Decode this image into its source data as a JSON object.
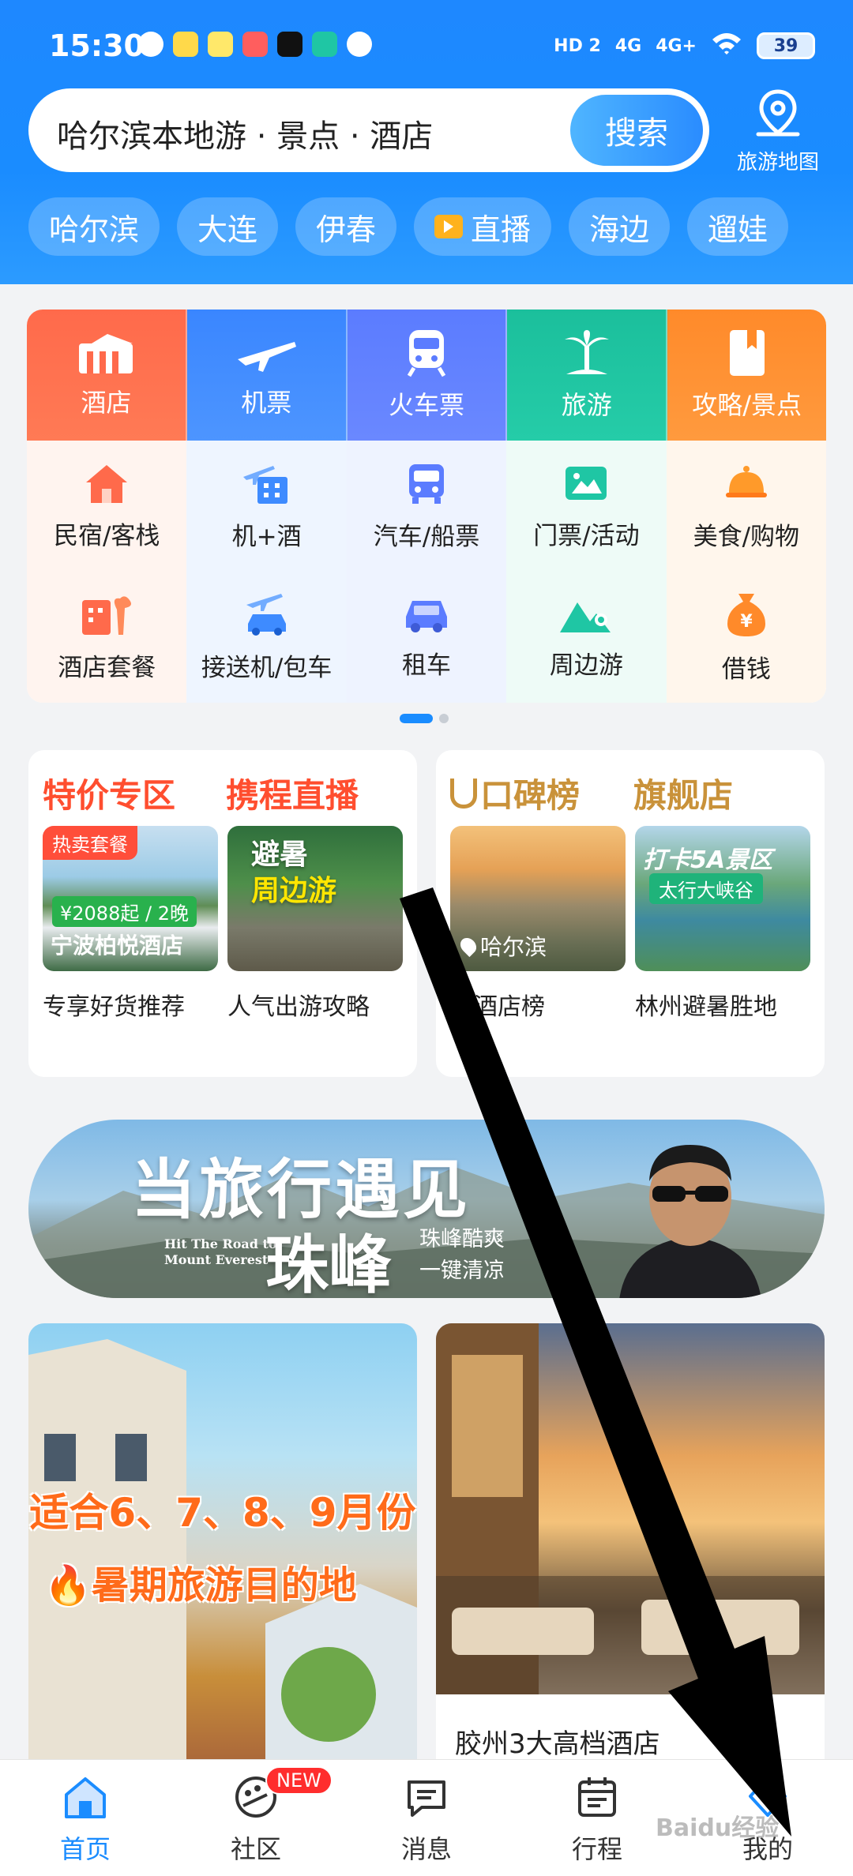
{
  "status": {
    "time": "15:30",
    "network1": "HD 2",
    "network2": "4G",
    "network3": "4G+",
    "battery": "39"
  },
  "search": {
    "text": "哈尔滨本地游 · 景点 · 酒店",
    "button": "搜索"
  },
  "map_button": {
    "label": "旅游地图"
  },
  "chips": [
    {
      "label": "哈尔滨"
    },
    {
      "label": "大连"
    },
    {
      "label": "伊春"
    },
    {
      "label": "直播"
    },
    {
      "label": "海边"
    },
    {
      "label": "遛娃"
    }
  ],
  "grid": {
    "row1": [
      {
        "label": "酒店"
      },
      {
        "label": "机票"
      },
      {
        "label": "火车票"
      },
      {
        "label": "旅游"
      },
      {
        "label": "攻略/景点"
      }
    ],
    "row2": [
      {
        "label": "民宿/客栈"
      },
      {
        "label": "机+酒"
      },
      {
        "label": "汽车/船票"
      },
      {
        "label": "门票/活动"
      },
      {
        "label": "美食/购物"
      }
    ],
    "row3": [
      {
        "label": "酒店套餐"
      },
      {
        "label": "接送机/包车"
      },
      {
        "label": "租车"
      },
      {
        "label": "周边游"
      },
      {
        "label": "借钱"
      }
    ]
  },
  "cards": {
    "left": {
      "title1": "特价专区",
      "title2": "携程直播",
      "item1": {
        "tag": "热卖套餐",
        "price": "¥2088起 / 2晚",
        "name": "宁波柏悦酒店",
        "caption": "专享好货推荐"
      },
      "item2": {
        "text1": "避暑",
        "text2": "周边游",
        "caption": "人气出游攻略"
      }
    },
    "right": {
      "title1": "口碑榜",
      "title2": "旗舰店",
      "item1": {
        "location": "哈尔滨",
        "caption": "景酒店榜"
      },
      "item2": {
        "text1": "打卡5A景区",
        "text2": "太行大峡谷",
        "caption": "林州避暑胜地"
      }
    }
  },
  "banner": {
    "title1": "当旅行遇见",
    "title2": "珠峰",
    "en1": "Hit The Road to",
    "en2": "Mount Everest",
    "sub1": "珠峰酷爽",
    "sub2": "一键清凉"
  },
  "feed": {
    "left": {
      "text1": "适合6、7、8、9月份",
      "text2": "🔥暑期旅游目的地"
    },
    "right": {
      "title": "胶州3大高档酒店"
    }
  },
  "tabs": [
    {
      "label": "首页"
    },
    {
      "label": "社区"
    },
    {
      "label": "消息"
    },
    {
      "label": "行程"
    },
    {
      "label": "我的"
    }
  ],
  "badge": "NEW",
  "watermark": "Baidu经验",
  "colors": {
    "brand": "#1a8cff",
    "hotel": "#ff6a4b",
    "air": "#3e8bff",
    "train": "#5b7cff",
    "tour": "#1fc6a4",
    "guide": "#ff8e2f"
  }
}
